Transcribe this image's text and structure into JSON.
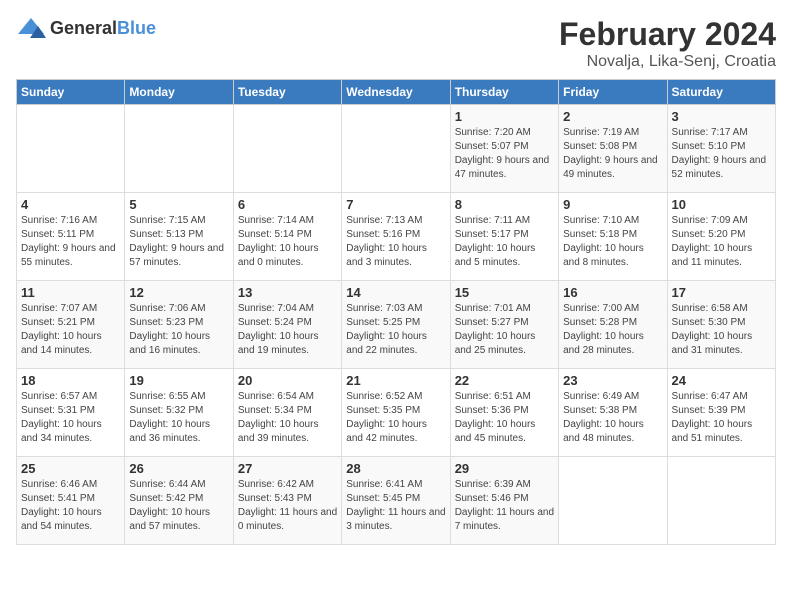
{
  "header": {
    "logo_general": "General",
    "logo_blue": "Blue",
    "month_year": "February 2024",
    "location": "Novalja, Lika-Senj, Croatia"
  },
  "weekdays": [
    "Sunday",
    "Monday",
    "Tuesday",
    "Wednesday",
    "Thursday",
    "Friday",
    "Saturday"
  ],
  "weeks": [
    [
      {
        "day": "",
        "info": ""
      },
      {
        "day": "",
        "info": ""
      },
      {
        "day": "",
        "info": ""
      },
      {
        "day": "",
        "info": ""
      },
      {
        "day": "1",
        "info": "Sunrise: 7:20 AM\nSunset: 5:07 PM\nDaylight: 9 hours and 47 minutes."
      },
      {
        "day": "2",
        "info": "Sunrise: 7:19 AM\nSunset: 5:08 PM\nDaylight: 9 hours and 49 minutes."
      },
      {
        "day": "3",
        "info": "Sunrise: 7:17 AM\nSunset: 5:10 PM\nDaylight: 9 hours and 52 minutes."
      }
    ],
    [
      {
        "day": "4",
        "info": "Sunrise: 7:16 AM\nSunset: 5:11 PM\nDaylight: 9 hours and 55 minutes."
      },
      {
        "day": "5",
        "info": "Sunrise: 7:15 AM\nSunset: 5:13 PM\nDaylight: 9 hours and 57 minutes."
      },
      {
        "day": "6",
        "info": "Sunrise: 7:14 AM\nSunset: 5:14 PM\nDaylight: 10 hours and 0 minutes."
      },
      {
        "day": "7",
        "info": "Sunrise: 7:13 AM\nSunset: 5:16 PM\nDaylight: 10 hours and 3 minutes."
      },
      {
        "day": "8",
        "info": "Sunrise: 7:11 AM\nSunset: 5:17 PM\nDaylight: 10 hours and 5 minutes."
      },
      {
        "day": "9",
        "info": "Sunrise: 7:10 AM\nSunset: 5:18 PM\nDaylight: 10 hours and 8 minutes."
      },
      {
        "day": "10",
        "info": "Sunrise: 7:09 AM\nSunset: 5:20 PM\nDaylight: 10 hours and 11 minutes."
      }
    ],
    [
      {
        "day": "11",
        "info": "Sunrise: 7:07 AM\nSunset: 5:21 PM\nDaylight: 10 hours and 14 minutes."
      },
      {
        "day": "12",
        "info": "Sunrise: 7:06 AM\nSunset: 5:23 PM\nDaylight: 10 hours and 16 minutes."
      },
      {
        "day": "13",
        "info": "Sunrise: 7:04 AM\nSunset: 5:24 PM\nDaylight: 10 hours and 19 minutes."
      },
      {
        "day": "14",
        "info": "Sunrise: 7:03 AM\nSunset: 5:25 PM\nDaylight: 10 hours and 22 minutes."
      },
      {
        "day": "15",
        "info": "Sunrise: 7:01 AM\nSunset: 5:27 PM\nDaylight: 10 hours and 25 minutes."
      },
      {
        "day": "16",
        "info": "Sunrise: 7:00 AM\nSunset: 5:28 PM\nDaylight: 10 hours and 28 minutes."
      },
      {
        "day": "17",
        "info": "Sunrise: 6:58 AM\nSunset: 5:30 PM\nDaylight: 10 hours and 31 minutes."
      }
    ],
    [
      {
        "day": "18",
        "info": "Sunrise: 6:57 AM\nSunset: 5:31 PM\nDaylight: 10 hours and 34 minutes."
      },
      {
        "day": "19",
        "info": "Sunrise: 6:55 AM\nSunset: 5:32 PM\nDaylight: 10 hours and 36 minutes."
      },
      {
        "day": "20",
        "info": "Sunrise: 6:54 AM\nSunset: 5:34 PM\nDaylight: 10 hours and 39 minutes."
      },
      {
        "day": "21",
        "info": "Sunrise: 6:52 AM\nSunset: 5:35 PM\nDaylight: 10 hours and 42 minutes."
      },
      {
        "day": "22",
        "info": "Sunrise: 6:51 AM\nSunset: 5:36 PM\nDaylight: 10 hours and 45 minutes."
      },
      {
        "day": "23",
        "info": "Sunrise: 6:49 AM\nSunset: 5:38 PM\nDaylight: 10 hours and 48 minutes."
      },
      {
        "day": "24",
        "info": "Sunrise: 6:47 AM\nSunset: 5:39 PM\nDaylight: 10 hours and 51 minutes."
      }
    ],
    [
      {
        "day": "25",
        "info": "Sunrise: 6:46 AM\nSunset: 5:41 PM\nDaylight: 10 hours and 54 minutes."
      },
      {
        "day": "26",
        "info": "Sunrise: 6:44 AM\nSunset: 5:42 PM\nDaylight: 10 hours and 57 minutes."
      },
      {
        "day": "27",
        "info": "Sunrise: 6:42 AM\nSunset: 5:43 PM\nDaylight: 11 hours and 0 minutes."
      },
      {
        "day": "28",
        "info": "Sunrise: 6:41 AM\nSunset: 5:45 PM\nDaylight: 11 hours and 3 minutes."
      },
      {
        "day": "29",
        "info": "Sunrise: 6:39 AM\nSunset: 5:46 PM\nDaylight: 11 hours and 7 minutes."
      },
      {
        "day": "",
        "info": ""
      },
      {
        "day": "",
        "info": ""
      }
    ]
  ]
}
